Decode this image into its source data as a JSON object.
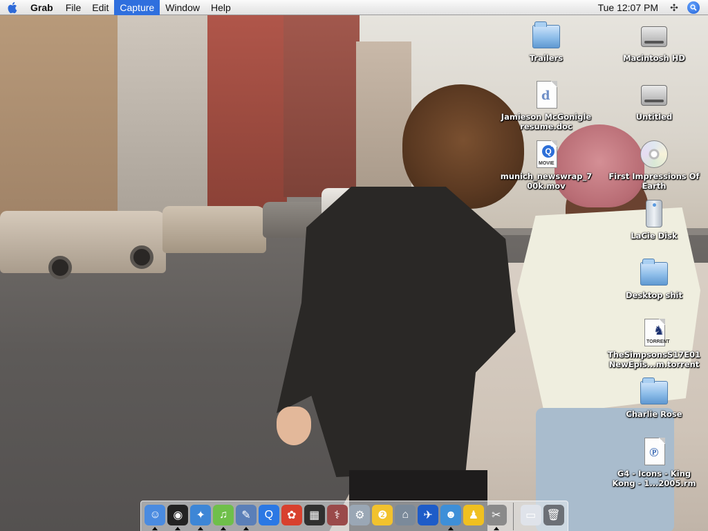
{
  "menubar": {
    "app_name": "Grab",
    "menus": [
      "File",
      "Edit",
      "Capture",
      "Window",
      "Help"
    ],
    "active_menu": "Capture",
    "clock": "Tue 12:07 PM"
  },
  "desktop": {
    "icons": [
      {
        "label": "Trailers",
        "type": "folder"
      },
      {
        "label": "Macintosh HD",
        "type": "hard-drive"
      },
      {
        "label": "Jamieson McGonigle\nresume.doc",
        "type": "word-document"
      },
      {
        "label": "Untitled",
        "type": "hard-drive"
      },
      {
        "label": "munich_newswrap_7\n00k.mov",
        "type": "quicktime-movie"
      },
      {
        "label": "First Impressions Of\nEarth",
        "type": "audio-cd"
      },
      {
        "label": "LaCie Disk",
        "type": "external-drive"
      },
      {
        "label": "Desktop shit",
        "type": "folder"
      },
      {
        "label": "TheSimpsonsS17E01\nNewEpis...m.torrent",
        "type": "torrent-file"
      },
      {
        "label": "Charlie Rose",
        "type": "folder"
      },
      {
        "label": "G4 - Icons - King\nKong - 1...2005.rm",
        "type": "realmedia-file"
      }
    ]
  },
  "dock": {
    "apps": [
      {
        "name": "finder-icon",
        "color": "#4a8be0",
        "glyph": "☺",
        "running": true
      },
      {
        "name": "dashboard-icon",
        "color": "#222222",
        "glyph": "◉",
        "running": true
      },
      {
        "name": "safari-icon",
        "color": "#3d86d6",
        "glyph": "✦",
        "running": true
      },
      {
        "name": "itunes-icon",
        "color": "#6fbf4a",
        "glyph": "♫",
        "running": true
      },
      {
        "name": "preview-icon",
        "color": "#5b7fb8",
        "glyph": "✎",
        "running": true
      },
      {
        "name": "quicktime-icon",
        "color": "#2b78e4",
        "glyph": "Q",
        "running": false
      },
      {
        "name": "popcorn-icon",
        "color": "#d8402e",
        "glyph": "✿",
        "running": false
      },
      {
        "name": "clapper-icon",
        "color": "#303030",
        "glyph": "▦",
        "running": false
      },
      {
        "name": "disk-utility-icon",
        "color": "#9a4a4a",
        "glyph": "⚕",
        "running": false
      },
      {
        "name": "system-preferences-icon",
        "color": "#9aa7b5",
        "glyph": "⚙",
        "running": false
      },
      {
        "name": "toast-icon",
        "color": "#f2c22e",
        "glyph": "❷",
        "running": false
      },
      {
        "name": "utility-icon",
        "color": "#7b8a9a",
        "glyph": "⌂",
        "running": false
      },
      {
        "name": "frog-icon",
        "color": "#1e5cc8",
        "glyph": "✈",
        "running": false
      },
      {
        "name": "messenger-icon",
        "color": "#3e8fd8",
        "glyph": "☻",
        "running": true
      },
      {
        "name": "aim-icon",
        "color": "#f0c020",
        "glyph": "♟",
        "running": false
      },
      {
        "name": "grab-icon",
        "color": "#8a8a8a",
        "glyph": "✂",
        "running": true
      }
    ],
    "docs": [
      {
        "name": "minimized-window-icon",
        "color": "#dfe3ea",
        "glyph": "▭",
        "running": false
      },
      {
        "name": "trash-icon",
        "color": "#6c7076",
        "glyph": "🗑",
        "running": false
      }
    ]
  },
  "colors": {
    "menu_highlight": "#2f6fde",
    "label_text": "#ffffff"
  }
}
